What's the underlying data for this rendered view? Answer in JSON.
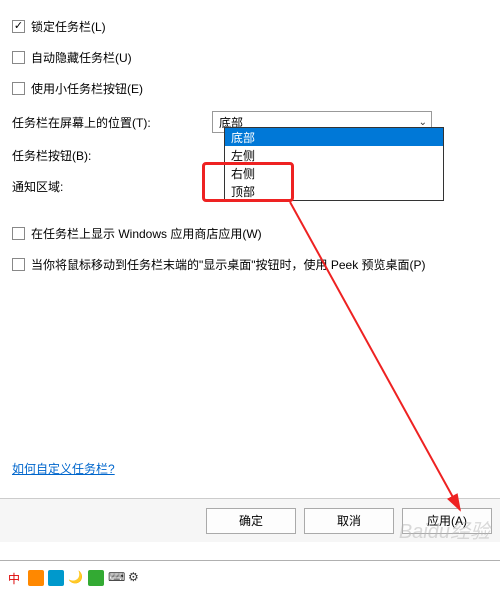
{
  "checkboxes": {
    "lock_taskbar": {
      "label": "锁定任务栏(L)",
      "checked": true
    },
    "auto_hide": {
      "label": "自动隐藏任务栏(U)",
      "checked": false
    },
    "small_buttons": {
      "label": "使用小任务栏按钮(E)",
      "checked": false
    },
    "show_store_apps": {
      "label": "在任务栏上显示 Windows 应用商店应用(W)",
      "checked": false
    },
    "peek_preview": {
      "label": "当你将鼠标移动到任务栏末端的\"显示桌面\"按钮时，使用 Peek 预览桌面(P)",
      "checked": false
    }
  },
  "labels": {
    "position": "任务栏在屏幕上的位置(T):",
    "buttons": "任务栏按钮(B):",
    "notification": "通知区域:"
  },
  "combobox": {
    "selected": "底部",
    "options": [
      "底部",
      "左侧",
      "右侧",
      "顶部"
    ]
  },
  "link": "如何自定义任务栏?",
  "buttons": {
    "ok": "确定",
    "cancel": "取消",
    "apply": "应用(A)"
  },
  "watermark": "Baidu经验"
}
